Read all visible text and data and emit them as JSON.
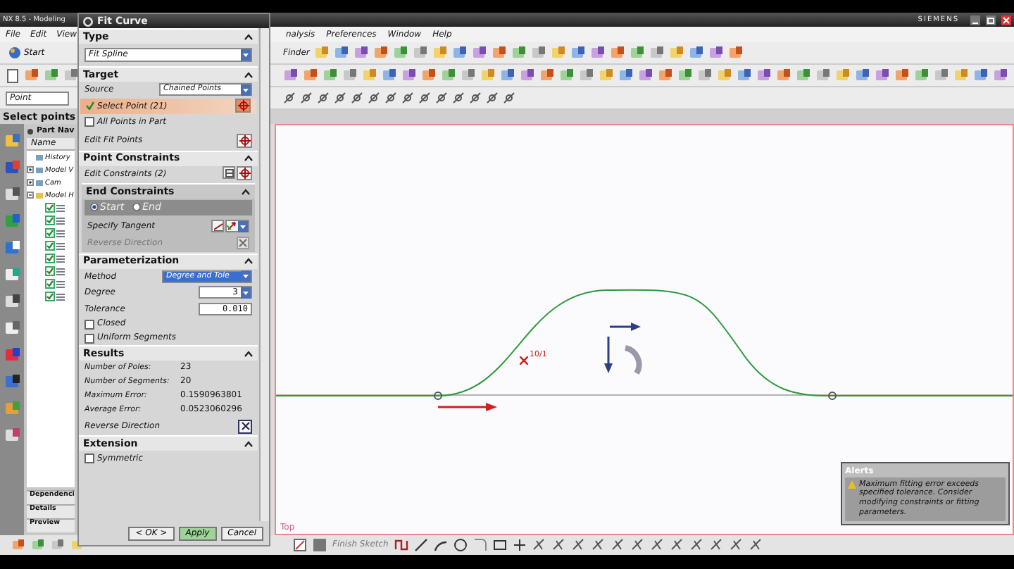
{
  "app": {
    "title": "NX 8.5 - Modeling",
    "brand": "SIEMENS"
  },
  "menu": [
    {
      "label": "File"
    },
    {
      "label": "Edit"
    },
    {
      "label": "View"
    },
    {
      "label": "nalysis"
    },
    {
      "label": "Preferences"
    },
    {
      "label": "Window"
    },
    {
      "label": "Help"
    }
  ],
  "toolbar": {
    "start": "Start",
    "finder": "Finder"
  },
  "selection_bar": {
    "filter": "Point",
    "prompt": "Select points"
  },
  "part_navigator": {
    "title": "Part Nav",
    "column": "Name",
    "tree": [
      {
        "label": "History"
      },
      {
        "label": "Model V",
        "expanded": false
      },
      {
        "label": "Cam",
        "expanded": false
      },
      {
        "label": "Model H",
        "expanded": true,
        "children": [
          {
            "checked": true
          },
          {
            "checked": true
          },
          {
            "checked": true
          },
          {
            "checked": true
          },
          {
            "checked": true
          },
          {
            "checked": true
          },
          {
            "checked": true
          },
          {
            "checked": true
          }
        ]
      }
    ],
    "bottom_tabs": [
      "Dependenci",
      "Details",
      "Preview"
    ]
  },
  "dialog": {
    "title": "Fit Curve",
    "type": {
      "title": "Type",
      "value": "Fit Spline"
    },
    "target": {
      "title": "Target",
      "source_label": "Source",
      "source": "Chained Points",
      "select_point": "Select Point (21)",
      "all_points": {
        "label": "All Points in Part",
        "checked": false
      },
      "edit_fit_points": "Edit Fit Points"
    },
    "point_constraints": {
      "title": "Point Constraints",
      "edit_constraints": "Edit Constraints (2)",
      "end_constraints": {
        "title": "End Constraints",
        "options": [
          {
            "label": "Start",
            "selected": true
          },
          {
            "label": "End",
            "selected": false
          }
        ],
        "specify_tangent": "Specify Tangent",
        "reverse_direction": {
          "label": "Reverse Direction",
          "disabled": true
        }
      }
    },
    "parameterization": {
      "title": "Parameterization",
      "fields": [
        {
          "label": "Method",
          "value": "Degree and Tole",
          "kind": "select"
        },
        {
          "label": "Degree",
          "value": "3",
          "kind": "spin"
        },
        {
          "label": "Tolerance",
          "value": "0.010",
          "kind": "text"
        }
      ],
      "checks": [
        {
          "label": "Closed",
          "checked": false
        },
        {
          "label": "Uniform Segments",
          "checked": false
        }
      ]
    },
    "results": {
      "title": "Results",
      "rows": [
        {
          "label": "Number of Poles:",
          "value": "23"
        },
        {
          "label": "Number of Segments:",
          "value": "20"
        },
        {
          "label": "Maximum Error:",
          "value": "0.1590963801"
        },
        {
          "label": "Average Error:",
          "value": "0.0523060296"
        }
      ],
      "reverse_direction": "Reverse Direction"
    },
    "extension": {
      "title": "Extension",
      "symmetric": {
        "label": "Symmetric",
        "checked": false
      }
    },
    "buttons": [
      "< OK >",
      "Apply",
      "Cancel"
    ]
  },
  "canvas": {
    "view": "Top",
    "point_label": "10/1",
    "alert": {
      "title": "Alerts",
      "message": "Maximum fitting error exceeds specified tolerance. Consider modifying constraints or fitting parameters."
    }
  },
  "sketch_toolbar": {
    "finish": "Finish Sketch"
  }
}
